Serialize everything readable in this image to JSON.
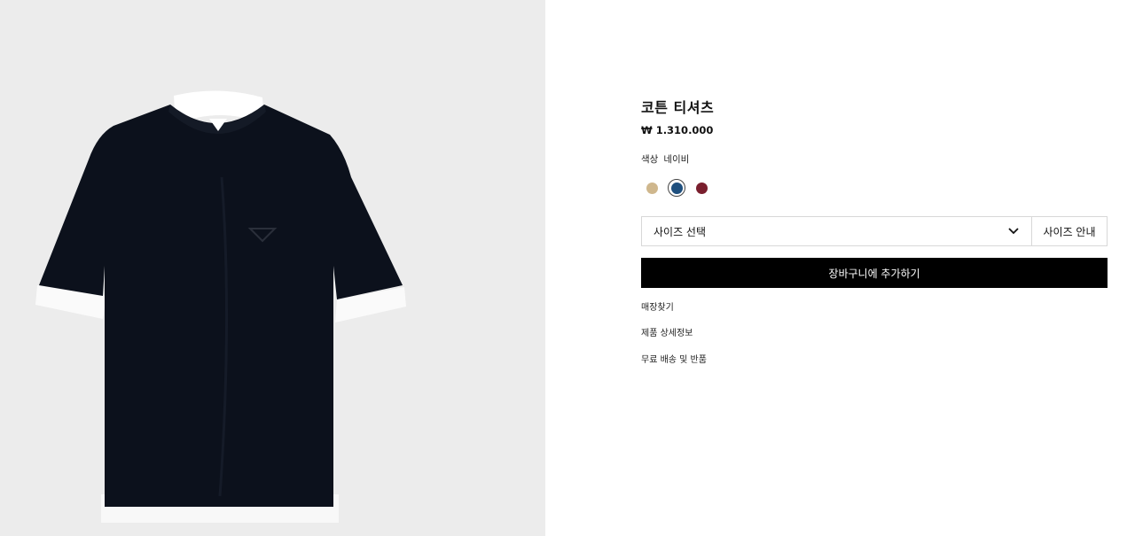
{
  "product": {
    "title": "코튼 티셔츠",
    "price": "₩ 1.310.000"
  },
  "color": {
    "label": "색상",
    "selected_name": "네이비",
    "swatches": [
      {
        "name": "beige",
        "hex": "#cfb78d",
        "selected": false
      },
      {
        "name": "navy",
        "hex": "#1e4f7e",
        "selected": true
      },
      {
        "name": "burgundy",
        "hex": "#7a1f2e",
        "selected": false
      }
    ]
  },
  "size": {
    "select_label": "사이즈 선택",
    "guide_label": "사이즈 안내"
  },
  "cart": {
    "add_label": "장바구니에 추가하기"
  },
  "links": {
    "store_finder": "매장찾기",
    "product_details": "제품 상세정보",
    "shipping_returns": "무료 배송 및 반품"
  },
  "icons": {
    "dropdown": "chevron-down-icon"
  },
  "colors": {
    "image_background": "#ececec",
    "shirt_body": "#0c111c",
    "button_background": "#000000"
  }
}
